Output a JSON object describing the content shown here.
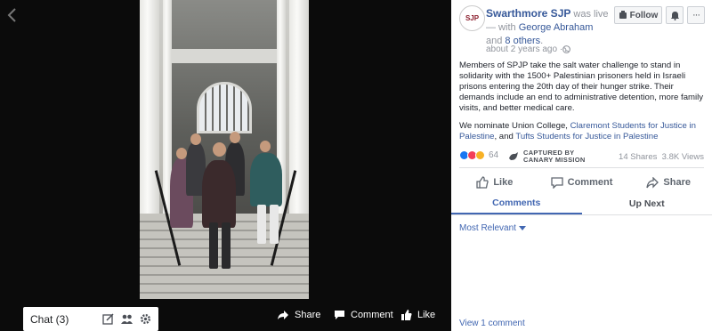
{
  "video": {
    "chat_label": "Chat (3)",
    "actions": {
      "share": "Share",
      "comment": "Comment",
      "like": "Like"
    }
  },
  "post": {
    "avatar_text": "SJP",
    "page_name": "Swarthmore SJP",
    "was_live": " was live",
    "with_prefix": "— with ",
    "with_name": "George Abraham",
    "and_text": " and ",
    "others": "8 others",
    "period": ".",
    "timestamp": "about 2 years ago · ",
    "follow_label": "Follow",
    "more_label": "···",
    "paragraph1": "Members of SPJP take the salt water challenge to stand in solidarity with the 1500+ Palestinian prisoners held in Israeli prisons entering the 20th day of their hunger strike. Their demands include an end to administrative detention, more family visits, and better medical care.",
    "paragraph2": {
      "prefix": "We nominate Union College, ",
      "link1": "Claremont Students for Justice in Palestine",
      "middle": ", and ",
      "link2": "Tufts Students for Justice in Palestine"
    },
    "reaction_count": "64",
    "reaction_colors": [
      "#1877f2",
      "#f33e58",
      "#f7b125"
    ],
    "captured_line1": "CAPTURED BY",
    "captured_line2": "CANARY MISSION",
    "shares": "14 Shares",
    "views": "3.8K Views",
    "actions": {
      "like": "Like",
      "comment": "Comment",
      "share": "Share"
    },
    "tabs": {
      "comments": "Comments",
      "up_next": "Up Next"
    },
    "sort_label": "Most Relevant",
    "view_comments": "View 1 comment"
  },
  "colors": {
    "link": "#365899",
    "accent": "#4267b2"
  }
}
